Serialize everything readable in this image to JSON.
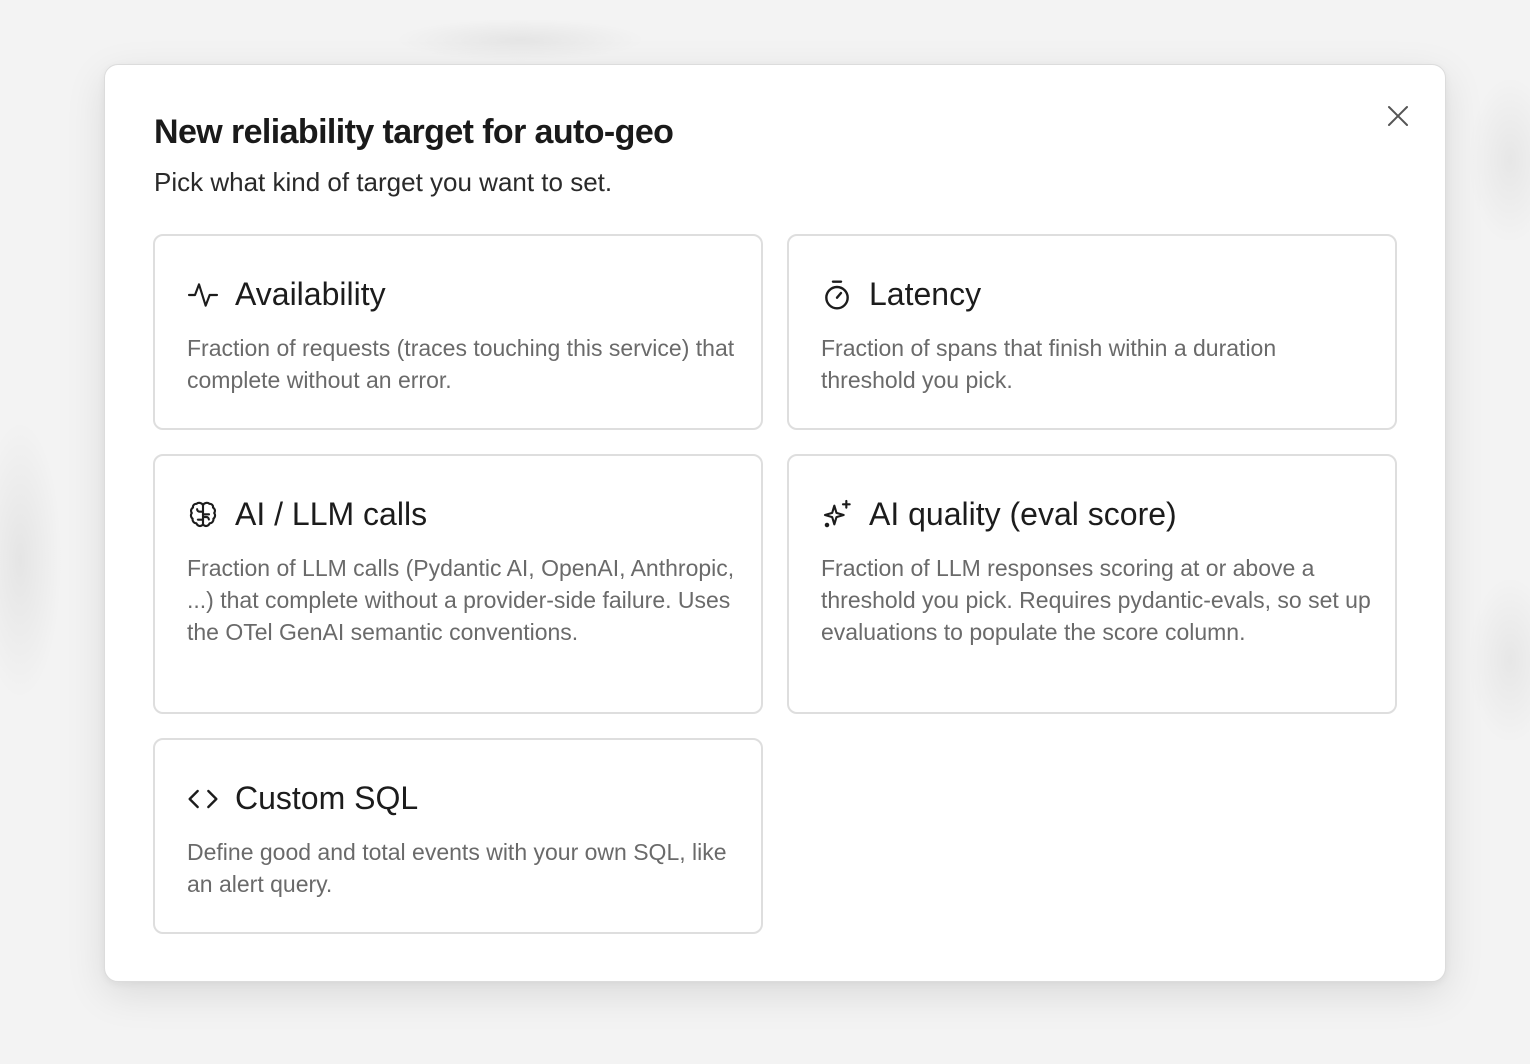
{
  "dialog": {
    "title": "New reliability target for auto-geo",
    "subtitle": "Pick what kind of target you want to set.",
    "close_icon": "close-icon"
  },
  "options": [
    {
      "id": "availability",
      "icon": "activity-icon",
      "label": "Availability",
      "description": "Fraction of requests (traces touching this service) that complete without an error."
    },
    {
      "id": "latency",
      "icon": "stopwatch-icon",
      "label": "Latency",
      "description": "Fraction of spans that finish within a duration threshold you pick."
    },
    {
      "id": "ai-llm",
      "icon": "brain-icon",
      "label": "AI / LLM calls",
      "description": "Fraction of LLM calls (Pydantic AI, OpenAI, Anthropic, ...) that complete without a provider-side failure. Uses the OTel GenAI semantic conventions."
    },
    {
      "id": "ai-quality",
      "icon": "sparkles-icon",
      "label": "AI quality (eval score)",
      "description": "Fraction of LLM responses scoring at or above a threshold you pick. Requires pydantic-evals, so set up evaluations to populate the score column."
    },
    {
      "id": "custom-sql",
      "icon": "code-icon",
      "label": "Custom SQL",
      "description": "Define good and total events with your own SQL, like an alert query."
    }
  ],
  "colors": {
    "card_border": "#dedede",
    "label_text": "#1c1c1c",
    "description_text": "#6a6a6a"
  }
}
